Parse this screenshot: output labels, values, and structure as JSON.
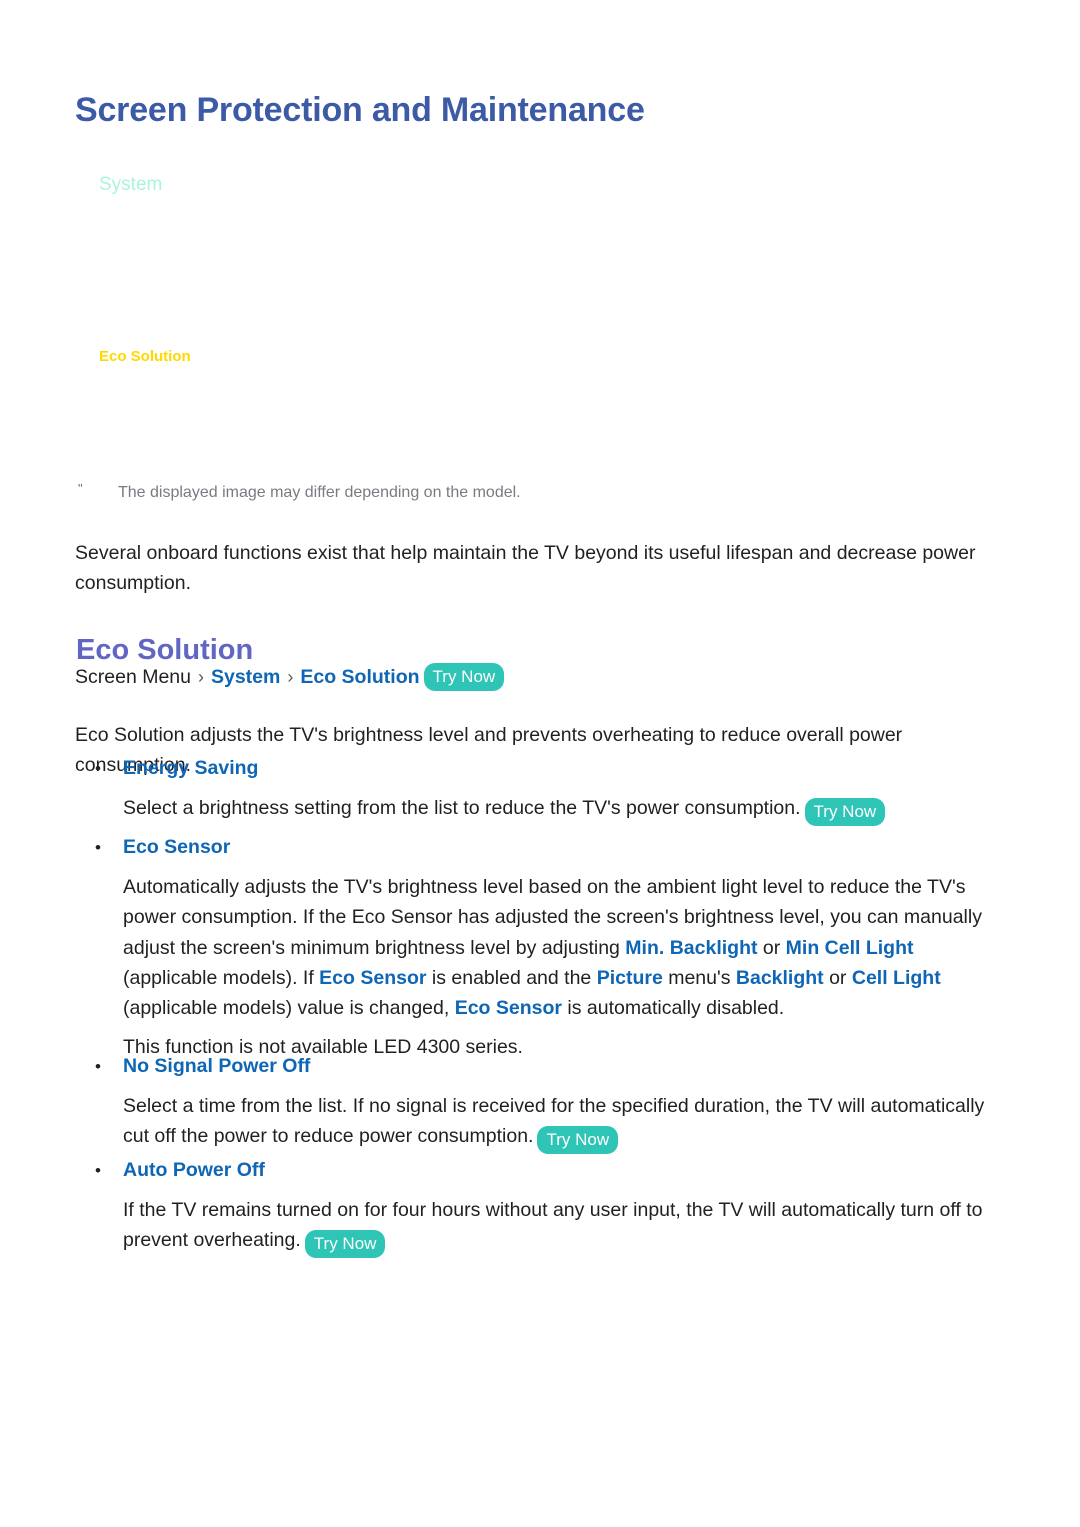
{
  "page": {
    "title": "Screen Protection and Maintenance"
  },
  "illustration": {
    "menu_system_label": "System",
    "menu_eco_solution_label": "Eco Solution",
    "colors": {
      "system_label": "#A9F5DC",
      "eco_solution_label": "#FFD800"
    }
  },
  "note": {
    "marker": "\"",
    "text": "The displayed image may differ depending on the model."
  },
  "intro": {
    "paragraph": "Several onboard functions exist that help maintain the TV beyond its useful lifespan and decrease power consumption."
  },
  "section": {
    "heading": "Eco Solution",
    "breadcrumb": {
      "root": "Screen Menu",
      "separator": "›",
      "level1": "System",
      "level2": "Eco Solution",
      "badge": "Try Now"
    },
    "description": "Eco Solution adjusts the TV's brightness level and prevents overheating to reduce overall power consumption."
  },
  "bullets": [
    {
      "id": "energy-saving",
      "marker": "•",
      "label": "Energy Saving",
      "body_before": "Select a brightness setting from the list to reduce the TV's power consumption.",
      "badge": "Try Now"
    },
    {
      "id": "eco-sensor",
      "marker": "•",
      "label": "Eco Sensor",
      "seg1": "Automatically adjusts the TV's brightness level based on the ambient light level to reduce the TV's power consumption. If the Eco Sensor has adjusted the screen's brightness level, you can manually adjust the screen's minimum brightness level by adjusting ",
      "term1": "Min. Backlight",
      "seg2": " or ",
      "term2": "Min Cell Light",
      "seg3": " (applicable models). If ",
      "term3": "Eco Sensor",
      "seg4": " is enabled and the ",
      "term4": "Picture",
      "seg5": " menu's ",
      "term5": "Backlight",
      "seg6": " or ",
      "term6": "Cell Light",
      "seg7": " (applicable models) value is changed, ",
      "term7": "Eco Sensor",
      "seg8": " is automatically disabled."
    },
    {
      "id": "no-signal-power-off",
      "marker": "•",
      "label": "No Signal Power Off",
      "body_before": "Select a time from the list. If no signal is received for the specified duration, the TV will automatically cut off the power to reduce power consumption.",
      "badge": "Try Now"
    },
    {
      "id": "auto-power-off",
      "marker": "•",
      "label": "Auto Power Off",
      "body_before": "If the TV remains turned on for four hours without any user input, the TV will automatically turn off to prevent overheating.",
      "badge": "Try Now"
    }
  ],
  "standalone_note": {
    "text": "This function is not available LED 4300 series."
  },
  "colors": {
    "title": "#3C5AA6",
    "section_heading": "#6166C4",
    "link_blue": "#0F66B4",
    "badge_teal": "#2EC4B6",
    "body_text": "#231F20",
    "note_gray": "#7A7A82"
  }
}
